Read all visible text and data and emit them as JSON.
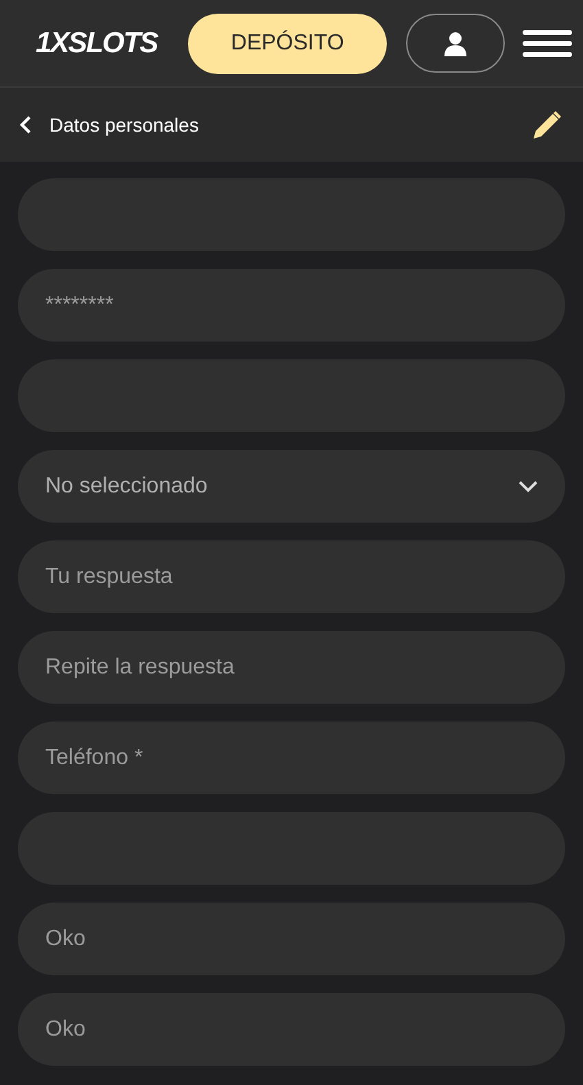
{
  "header": {
    "logo": "1XSLOTS",
    "deposit_button": "DEPÓSITO"
  },
  "subheader": {
    "title": "Datos personales"
  },
  "fields": [
    {
      "kind": "input"
    },
    {
      "kind": "input",
      "value": "********"
    },
    {
      "kind": "input"
    },
    {
      "kind": "select",
      "value": "No seleccionado"
    },
    {
      "kind": "input",
      "placeholder": "Tu respuesta"
    },
    {
      "kind": "input",
      "placeholder": "Repite la respuesta"
    },
    {
      "kind": "input",
      "placeholder": "Teléfono *"
    },
    {
      "kind": "input"
    },
    {
      "kind": "input",
      "value": "Oko"
    },
    {
      "kind": "input",
      "value": "Oko"
    }
  ]
}
